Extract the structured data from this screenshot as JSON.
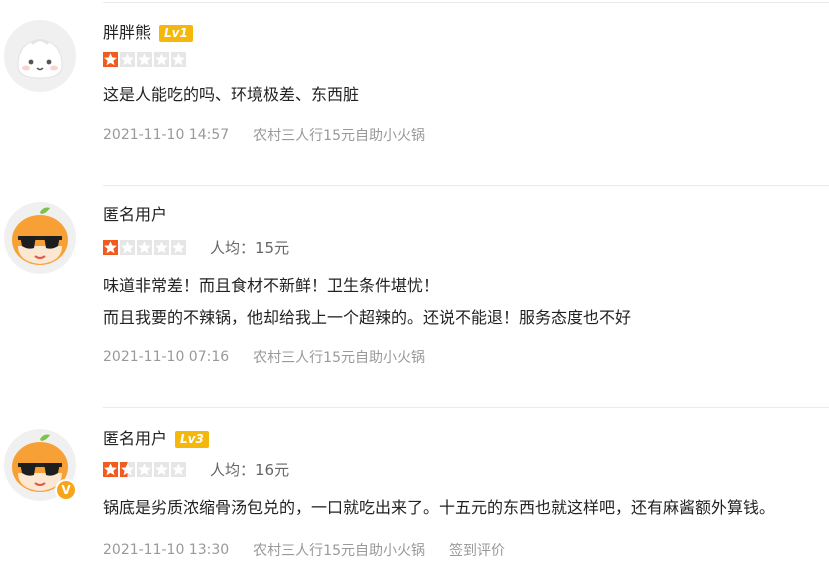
{
  "colors": {
    "star_filled": "#f25a1e",
    "star_empty": "#e6e6e6",
    "badge": "#f5b80a",
    "meta_text": "#999999"
  },
  "reviews": [
    {
      "avatar_icon": "steamed-bun-avatar-icon",
      "username": "胖胖熊",
      "level": "Lv1",
      "rating": 1,
      "rating_max": 5,
      "price": "",
      "content_lines": [
        "这是人能吃的吗、环境极差、东西脏"
      ],
      "date": "2021-11-10 14:57",
      "shop": "农村三人行15元自助小火锅",
      "source": ""
    },
    {
      "avatar_icon": "orange-sunglasses-avatar-icon",
      "username": "匿名用户",
      "level": "",
      "rating": 1,
      "rating_max": 5,
      "price": "人均：15元",
      "content_lines": [
        "味道非常差！而且食材不新鲜！卫生条件堪忧！",
        "而且我要的不辣锅，他却给我上一个超辣的。还说不能退！服务态度也不好"
      ],
      "date": "2021-11-10 07:16",
      "shop": "农村三人行15元自助小火锅",
      "source": ""
    },
    {
      "avatar_icon": "orange-sunglasses-avatar-icon",
      "avatar_badge": "V",
      "username": "匿名用户",
      "level": "Lv3",
      "rating": 1.5,
      "rating_max": 5,
      "price": "人均：16元",
      "content_lines": [
        "锅底是劣质浓缩骨汤包兑的，一口就吃出来了。十五元的东西也就这样吧，还有麻酱额外算钱。"
      ],
      "date": "2021-11-10 13:30",
      "shop": "农村三人行15元自助小火锅",
      "source": "签到评价"
    }
  ]
}
